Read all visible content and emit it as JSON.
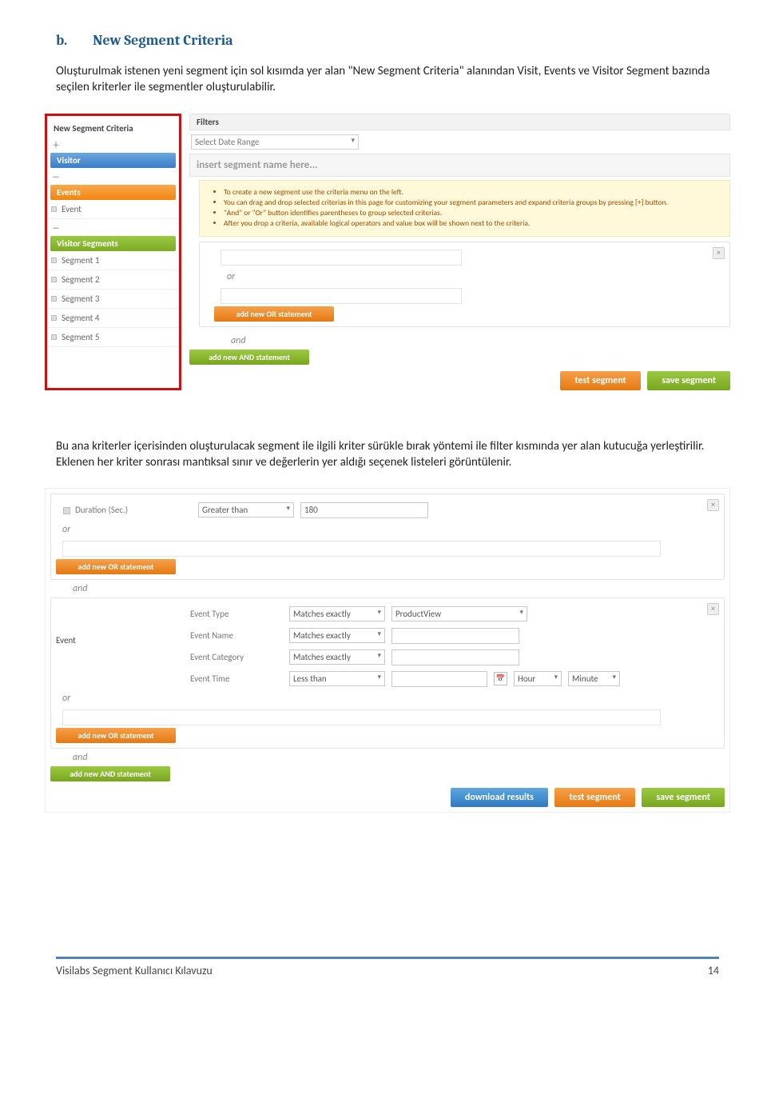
{
  "heading": {
    "label": "b.",
    "title": "New Segment Criteria"
  },
  "para1": "Oluşturulmak istenen yeni segment için sol kısımda yer alan \"New Segment Criteria\" alanından Visit, Events ve Visitor Segment bazında seçilen kriterler ile segmentler oluşturulabilir.",
  "para2": "Bu ana kriterler içerisinden oluşturulacak segment ile ilgili kriter sürükle bırak yöntemi ile filter kısmında yer alan kutucuğa yerleştirilir. Eklenen her kriter sonrası mantıksal sınır ve değerlerin yer aldığı seçenek listeleri görüntülenir.",
  "ss1": {
    "sidebar": {
      "title": "New Segment Criteria",
      "visitor_header": "Visitor",
      "events_header": "Events",
      "event_item": "Event",
      "vs_header": "Visitor Segments",
      "segments": [
        "Segment 1",
        "Segment 2",
        "Segment 3",
        "Segment 4",
        "Segment 5"
      ]
    },
    "right": {
      "filters_label": "Filters",
      "date_label": "Select Date Range",
      "seg_name_placeholder": "insert segment name here...",
      "hints": [
        "To create a new segment use the criteria menu on the left.",
        "You can drag and drop selected criterias in this page for customizing your segment parameters and expand criteria groups by pressing [+] button.",
        "\"And\" or \"Or\" button identifies parentheses to group selected criterias.",
        "After you drop a criteria, available logical operators and value box will be shown next to the criteria."
      ],
      "or_label": "or",
      "add_or": "add new OR statement",
      "and_label": "and",
      "add_and": "add new AND statement",
      "btn_test": "test segment",
      "btn_save": "save segment"
    }
  },
  "ss2": {
    "row_duration_label": "Duration (Sec.)",
    "op_gt": "Greater than",
    "val_180": "180",
    "or_label": "or",
    "add_or": "add new OR statement",
    "and_label": "and",
    "add_and": "add new AND statement",
    "event_label": "Event",
    "event_rows": [
      {
        "label": "Event Type",
        "op": "Matches exactly",
        "val": "ProductView"
      },
      {
        "label": "Event Name",
        "op": "Matches exactly",
        "val": ""
      },
      {
        "label": "Event Category",
        "op": "Matches exactly",
        "val": ""
      }
    ],
    "event_time_label": "Event Time",
    "op_lt": "Less than",
    "hour": "Hour",
    "minute": "Minute",
    "btn_download": "download results",
    "btn_test": "test segment",
    "btn_save": "save segment"
  },
  "footer": {
    "title": "Visilabs Segment Kullanıcı Kılavuzu",
    "page": "14"
  }
}
